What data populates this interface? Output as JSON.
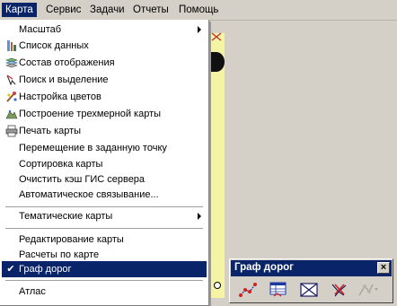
{
  "menubar": {
    "items": [
      "Карта",
      "Сервис",
      "Задачи",
      "Отчеты",
      "Помощь"
    ]
  },
  "menu": {
    "items": [
      {
        "label": "Масштаб",
        "submenu": true
      },
      {
        "label": "Список данных",
        "icon": "data-list-icon"
      },
      {
        "label": "Состав отображения",
        "icon": "layers-icon"
      },
      {
        "label": "Поиск и выделение",
        "icon": "search-select-icon"
      },
      {
        "label": "Настройка цветов",
        "icon": "palette-icon"
      },
      {
        "label": "Построение трехмерной карты",
        "icon": "3d-map-icon"
      },
      {
        "label": "Печать карты",
        "icon": "printer-icon"
      },
      {
        "label": "Перемещение в заданную точку"
      },
      {
        "label": "Сортировка карты"
      },
      {
        "label": "Очистить кэш ГИС сервера"
      },
      {
        "label": "Автоматическое связывание..."
      },
      {
        "label": "Тематические карты",
        "submenu": true
      },
      {
        "label": "Редактирование карты"
      },
      {
        "label": "Расчеты по карте"
      },
      {
        "label": "Граф дорог",
        "checked": true,
        "selected": true
      },
      {
        "label": "Атлас"
      }
    ]
  },
  "toolbar": {
    "title": "Граф дорог",
    "close_label": "×",
    "buttons": [
      "graph-nodes-icon",
      "graph-table-icon",
      "envelope-graph-icon",
      "delete-graph-icon",
      "disabled-graph-tool-icon"
    ]
  },
  "colors": {
    "menu_highlight": "#0a246a",
    "map_background": "#f5f4a5"
  }
}
